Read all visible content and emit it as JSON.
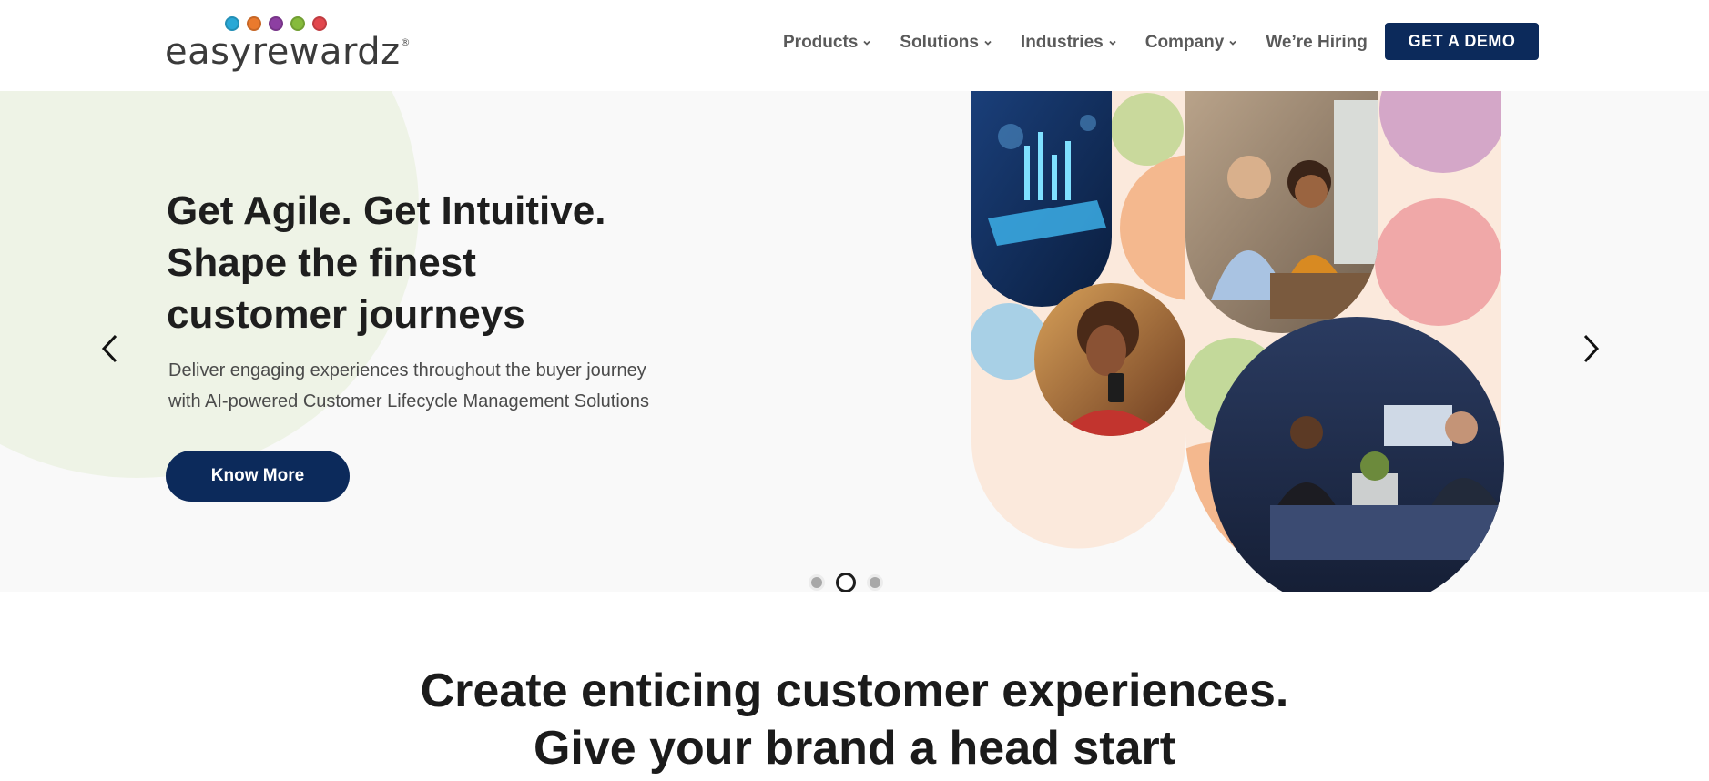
{
  "brand": {
    "name": "easyrewardz",
    "registered_mark": "®",
    "dot_colors": [
      "#2aa8d6",
      "#ea7a2d",
      "#8d3fa2",
      "#86bb3c",
      "#e2474d"
    ]
  },
  "nav": {
    "items": [
      {
        "label": "Products",
        "has_dropdown": true
      },
      {
        "label": "Solutions",
        "has_dropdown": true
      },
      {
        "label": "Industries",
        "has_dropdown": true
      },
      {
        "label": "Company",
        "has_dropdown": true
      },
      {
        "label": "We’re Hiring",
        "has_dropdown": false
      }
    ],
    "cta_label": "GET A DEMO",
    "chevron_icon": "chevron-down-icon"
  },
  "hero": {
    "title_line1": "Get Agile. Get Intuitive.",
    "title_line2": "Shape the finest",
    "title_line3": "customer journeys",
    "subtitle_line1": "Deliver engaging experiences throughout the buyer journey",
    "subtitle_line2": "with AI-powered Customer Lifecycle Management Solutions",
    "cta_label": "Know More",
    "prev_icon": "chevron-left-icon",
    "next_icon": "chevron-right-icon",
    "slides_total": 3,
    "active_slide": 2
  },
  "section": {
    "title_line1": "Create enticing customer experiences.",
    "title_line2": "Give your brand a head start"
  },
  "colors": {
    "primary": "#0c2a5b",
    "hero_bg": "#f9f9f9",
    "hero_blob": "#eef3e6",
    "nav_text": "#5a5a5a"
  }
}
